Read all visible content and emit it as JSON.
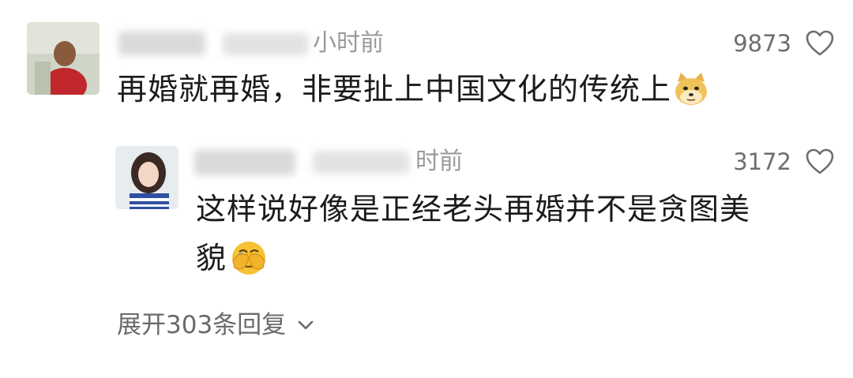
{
  "comments": [
    {
      "time_suffix": "小时前",
      "likes": "9873",
      "text": "再婚就再婚，非要扯上中国文化的传统上",
      "emoji": "doge-emoji"
    },
    {
      "time_suffix": "时前",
      "likes": "3172",
      "text_line1": "这样说好像是正经老头再婚并不是贪图美",
      "text_line2": "貌",
      "emoji": "facepalm-crying-emoji"
    }
  ],
  "expand_replies": {
    "label": "展开303条回复",
    "icon": "chevron-down-icon"
  },
  "colors": {
    "time": "#9a9a9a",
    "count": "#6e6e6e",
    "text": "#1b1b1b"
  }
}
